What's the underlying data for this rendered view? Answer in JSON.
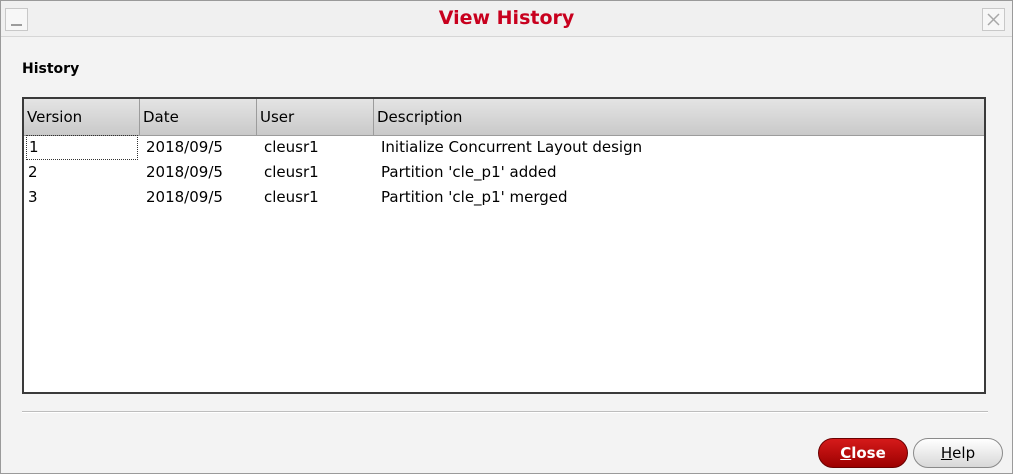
{
  "window": {
    "title": "View History",
    "title_color": "#c8001e"
  },
  "section": {
    "label": "History"
  },
  "table": {
    "columns": [
      "Version",
      "Date",
      "User",
      "Description"
    ],
    "rows": [
      {
        "version": "1",
        "date": "2018/09/5",
        "user": "cleusr1",
        "description": "Initialize Concurrent Layout design"
      },
      {
        "version": "2",
        "date": "2018/09/5",
        "user": "cleusr1",
        "description": "Partition 'cle_p1' added"
      },
      {
        "version": "3",
        "date": "2018/09/5",
        "user": "cleusr1",
        "description": "Partition 'cle_p1' merged"
      }
    ]
  },
  "buttons": {
    "close": {
      "accel": "C",
      "rest": "lose"
    },
    "help": {
      "accel": "H",
      "rest": "elp"
    }
  },
  "icons": {
    "minimize": "minimize-icon",
    "close": "close-icon"
  },
  "colors": {
    "primary_button": "#c00000",
    "window_bg": "#f3f3f3"
  }
}
